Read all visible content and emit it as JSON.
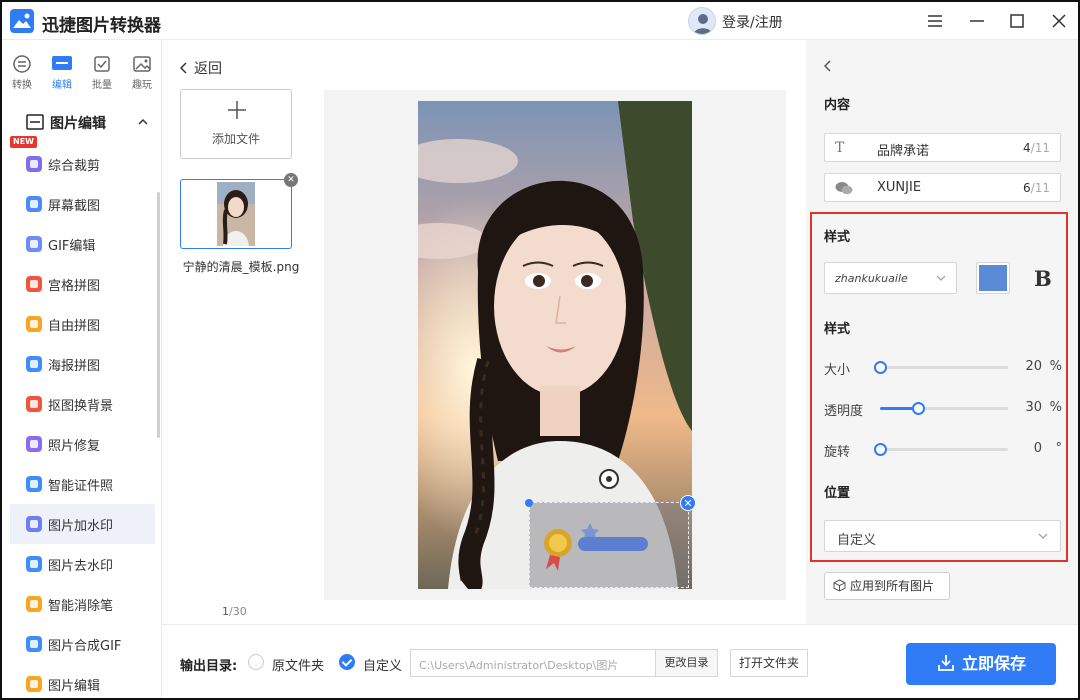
{
  "app": {
    "title": "迅捷图片转换器",
    "login_label": "登录/注册"
  },
  "top_tabs": [
    {
      "label": "转换",
      "icon": "convert-icon"
    },
    {
      "label": "编辑",
      "icon": "edit-icon",
      "active": true
    },
    {
      "label": "批量",
      "icon": "batch-icon"
    },
    {
      "label": "趣玩",
      "icon": "fun-icon"
    }
  ],
  "sidebar": {
    "section_title": "图片编辑",
    "new_badge": "NEW",
    "items": [
      {
        "label": "综合裁剪",
        "color": "#7f6cf0"
      },
      {
        "label": "屏幕截图",
        "color": "#4a8cf5"
      },
      {
        "label": "GIF编辑",
        "color": "#6d8cf5"
      },
      {
        "label": "宫格拼图",
        "color": "#f0563c"
      },
      {
        "label": "自由拼图",
        "color": "#f5a623"
      },
      {
        "label": "海报拼图",
        "color": "#3d8ef5"
      },
      {
        "label": "抠图换背景",
        "color": "#f0563c"
      },
      {
        "label": "照片修复",
        "color": "#8b6cf0"
      },
      {
        "label": "智能证件照",
        "color": "#3d8ef5"
      },
      {
        "label": "图片加水印",
        "color": "#6c7ef0",
        "active": true
      },
      {
        "label": "图片去水印",
        "color": "#3d8ef5"
      },
      {
        "label": "智能消除笔",
        "color": "#f5a623"
      },
      {
        "label": "图片合成GIF",
        "color": "#3d8ef5"
      },
      {
        "label": "图片编辑",
        "color": "#f5a623"
      }
    ]
  },
  "main": {
    "back_label": "返回",
    "add_file_label": "添加文件",
    "thumbnail_filename": "宁静的清晨_模板.png",
    "page_current": "1",
    "page_total": "/30"
  },
  "bottom": {
    "output_dir_label": "输出目录:",
    "option_original": "原文件夹",
    "option_custom": "自定义",
    "path_value": "C:\\Users\\Administrator\\Desktop\\图片",
    "change_dir_label": "更改目录",
    "open_folder_label": "打开文件夹",
    "save_label": "立即保存"
  },
  "panel": {
    "content_heading": "内容",
    "text_fields": [
      {
        "icon": "T",
        "value": "品牌承诺",
        "count": "4",
        "max": "/11"
      },
      {
        "icon": "wechat-icon",
        "value": "XUNJIE",
        "count": "6",
        "max": "/11"
      }
    ],
    "style_heading": "样式",
    "font_value": "zhankukuaile",
    "color_value": "#5b8bd6",
    "bold_label": "B",
    "style_heading_2": "样式",
    "sliders": [
      {
        "label": "大小",
        "value": "20",
        "unit": "%",
        "fraction": 0.0
      },
      {
        "label": "透明度",
        "value": "30",
        "unit": "%",
        "fraction": 0.3
      },
      {
        "label": "旋转",
        "value": "0",
        "unit": "°",
        "fraction": 0.0
      }
    ],
    "position_heading": "位置",
    "position_value": "自定义",
    "apply_all_label": "应用到所有图片"
  },
  "colors": {
    "accent": "#2f7cf6",
    "highlight_border": "#e0342d"
  }
}
